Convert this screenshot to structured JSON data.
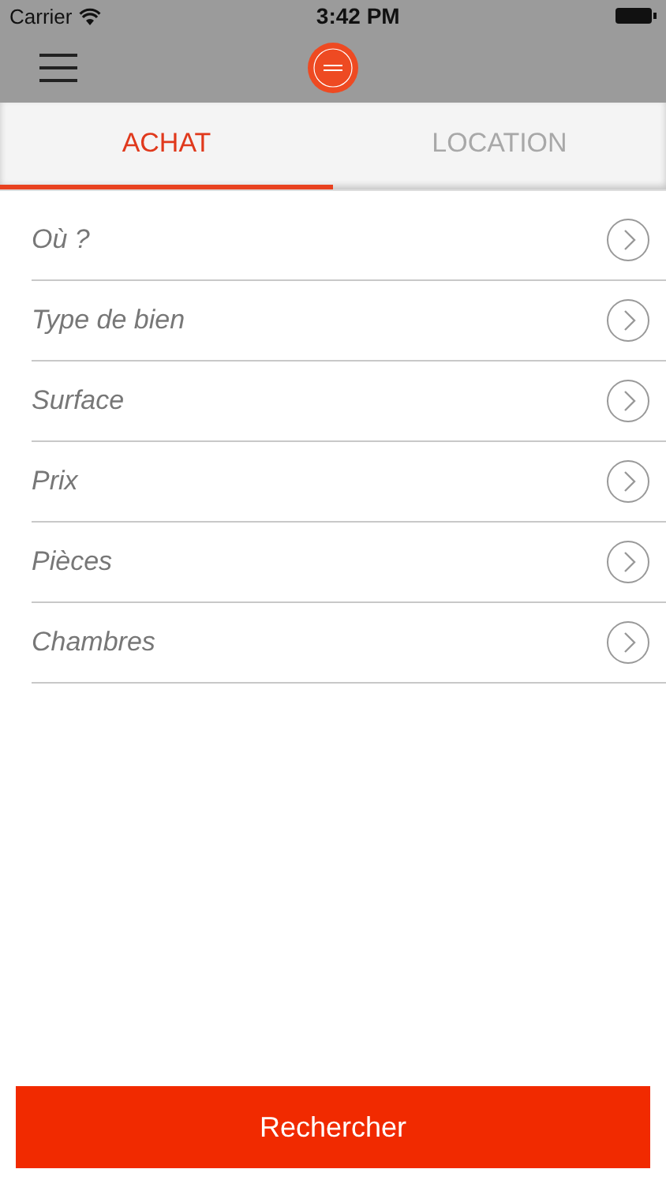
{
  "status_bar": {
    "carrier": "Carrier",
    "time": "3:42 PM"
  },
  "tabs": [
    {
      "label": "ACHAT",
      "selected": true
    },
    {
      "label": "LOCATION",
      "selected": false
    }
  ],
  "fields": [
    {
      "label": "Où ?"
    },
    {
      "label": "Type de bien"
    },
    {
      "label": "Surface"
    },
    {
      "label": "Prix"
    },
    {
      "label": "Pièces"
    },
    {
      "label": "Chambres"
    }
  ],
  "search_button": "Rechercher"
}
